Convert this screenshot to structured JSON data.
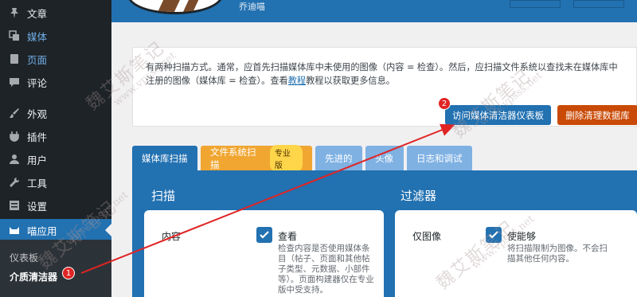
{
  "sidebar": {
    "items": [
      {
        "label": "文章",
        "icon": "pin-icon"
      },
      {
        "label": "媒体",
        "icon": "media-icon"
      },
      {
        "label": "页面",
        "icon": "pages-icon"
      },
      {
        "label": "评论",
        "icon": "comment-icon"
      },
      {
        "label": "外观",
        "icon": "brush-icon"
      },
      {
        "label": "插件",
        "icon": "plugin-icon"
      },
      {
        "label": "用户",
        "icon": "user-icon"
      },
      {
        "label": "工具",
        "icon": "wrench-icon"
      },
      {
        "label": "设置",
        "icon": "settings-icon"
      },
      {
        "label": "喵应用",
        "icon": "meow-icon"
      }
    ],
    "submenu": {
      "dashboard": "仪表板",
      "media_cleaner": "介质清洁器"
    }
  },
  "header": {
    "app_name": "乔迪喵"
  },
  "info": {
    "text_before_link": "有两种扫描方式。通常，应首先扫描媒体库中未使用的图像（内容 = 检查）。然后，应扫描文件系统以查找未在媒体库中注册的图像（媒体库 = 检查）。查看",
    "link_text": "教程",
    "text_after_link": "教程以获取更多信息。",
    "btn_dashboard": "访问媒体清洁器仪表板",
    "btn_delete": "删除清理数据库"
  },
  "tabs": {
    "media_scan": "媒体库扫描",
    "fs_scan": "文件系统扫描",
    "pro_badge": "专业版",
    "advanced": "先进的",
    "more": "头像",
    "logs": "日志和调试"
  },
  "scan": {
    "title": "扫描",
    "content_label": "内容",
    "check_title": "查看",
    "check_desc": "检查内容是否使用媒体条目（帖子、页面和其他帖子类型、元数据、小部件等）。页面构建器仅在专业版中受支持。"
  },
  "filters": {
    "title": "过滤器",
    "images_only_label": "仅图像",
    "enable_title": "使能够",
    "enable_desc": "将扫描限制为图像。不会扫描其他任何内容。"
  },
  "annotations": {
    "badge_1": "1",
    "badge_2": "2",
    "watermark_text": "魏艾斯笔记",
    "watermark_url": "www.vpsss.net"
  },
  "colors": {
    "sidebar_bg": "#1d2327",
    "accent_blue": "#2271b1",
    "danger_orange": "#c94a06",
    "pro_orange": "#f0a631",
    "annotation_red": "#e02424"
  }
}
